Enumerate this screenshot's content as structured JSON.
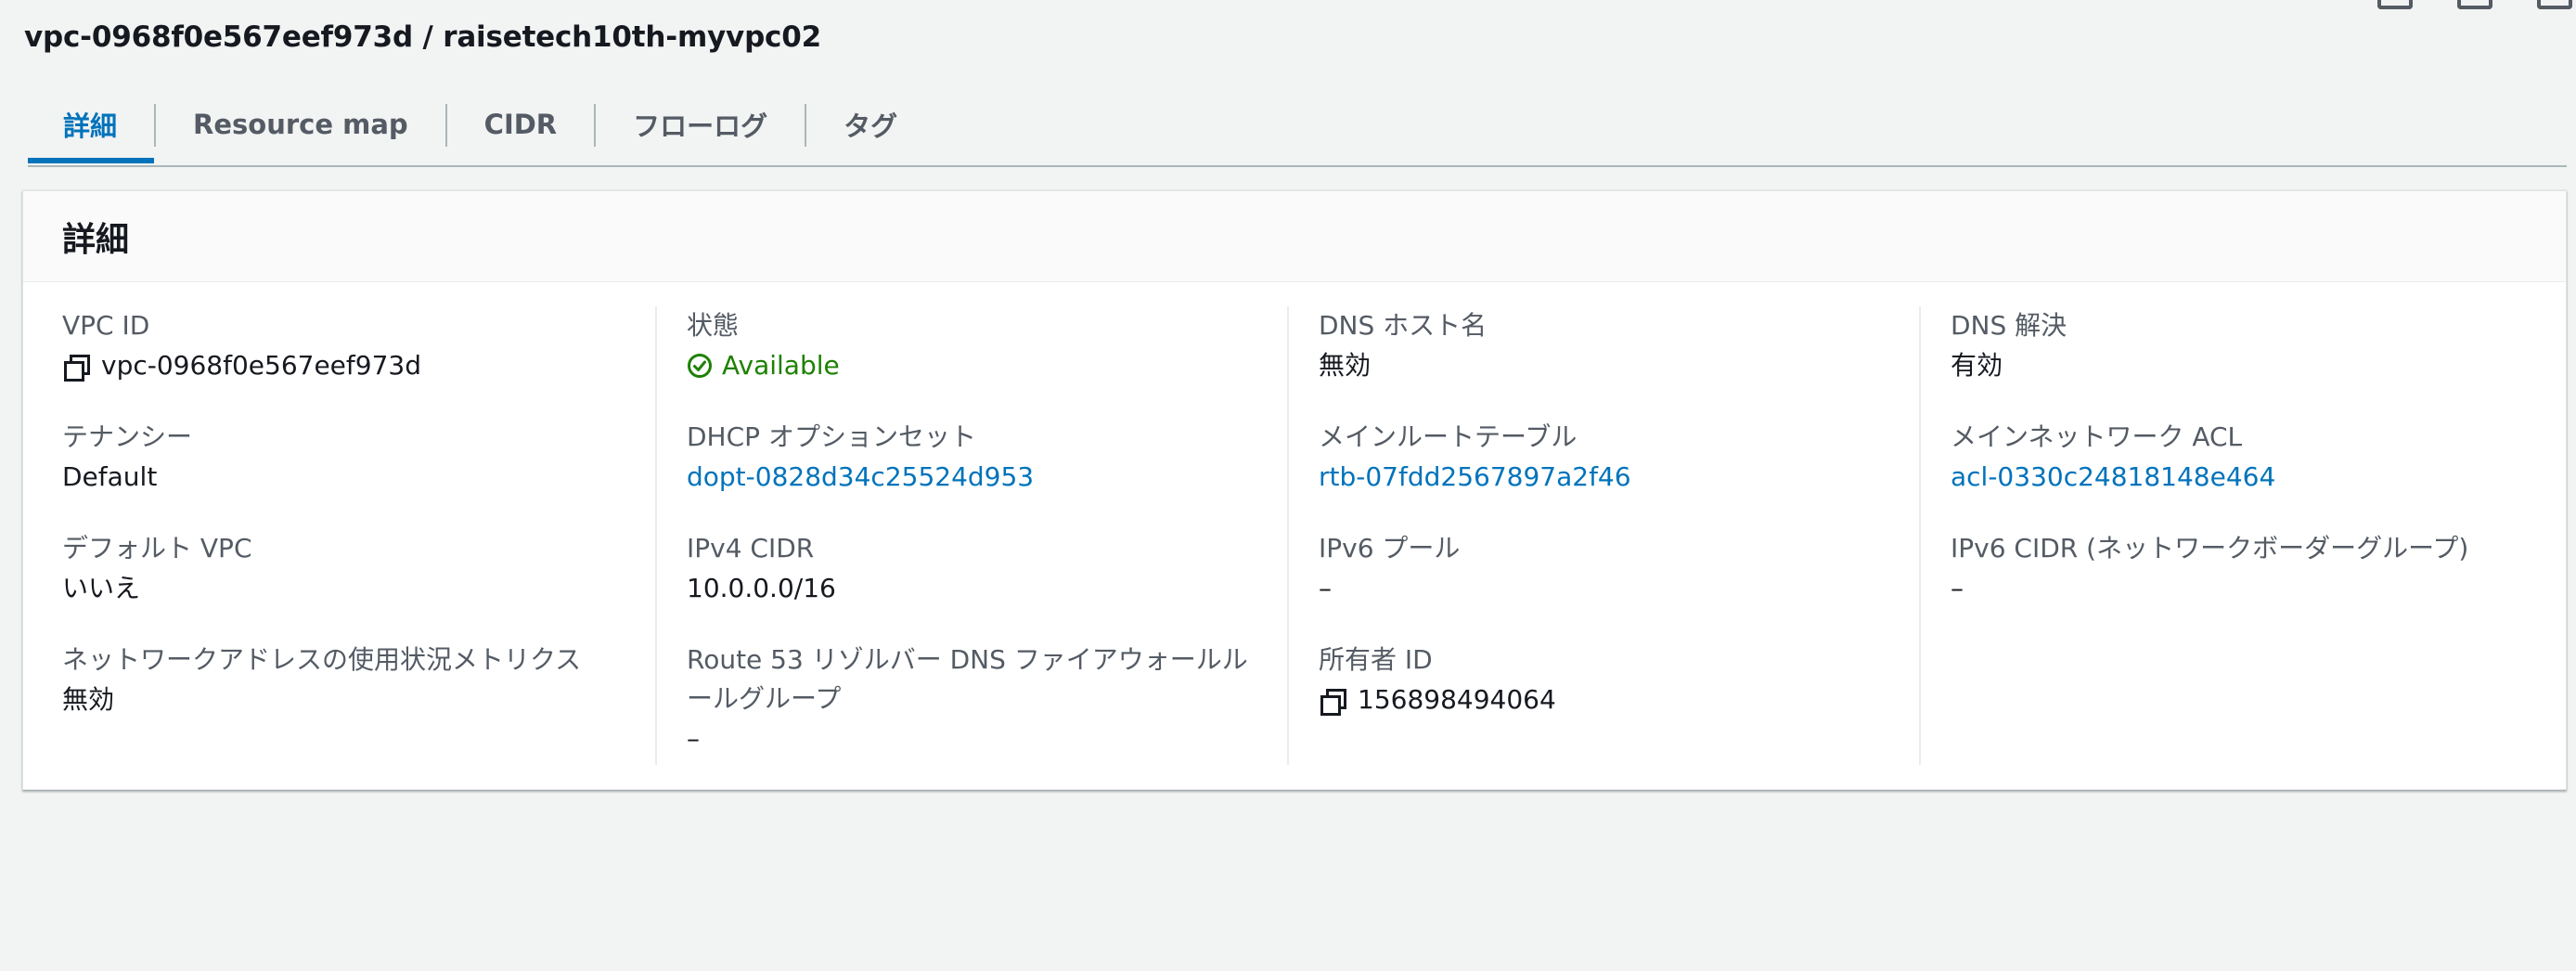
{
  "header": {
    "title": "vpc-0968f0e567eef973d / raisetech10th-myvpc02"
  },
  "tabs": [
    {
      "label": "詳細",
      "active": true
    },
    {
      "label": "Resource map",
      "active": false
    },
    {
      "label": "CIDR",
      "active": false
    },
    {
      "label": "フローログ",
      "active": false
    },
    {
      "label": "タグ",
      "active": false
    }
  ],
  "panel": {
    "title": "詳細",
    "columns": [
      [
        {
          "label": "VPC ID",
          "value": "vpc-0968f0e567eef973d",
          "copy_icon": "copy-icon"
        },
        {
          "label": "テナンシー",
          "value": "Default"
        },
        {
          "label": "デフォルト VPC",
          "value": "いいえ"
        },
        {
          "label": "ネットワークアドレスの使用状況メトリクス",
          "value": "無効"
        }
      ],
      [
        {
          "label": "状態",
          "value": "Available",
          "status_icon": "status-available-icon"
        },
        {
          "label": "DHCP オプションセット",
          "value": "dopt-0828d34c25524d953"
        },
        {
          "label": "IPv4 CIDR",
          "value": "10.0.0.0/16"
        },
        {
          "label": "Route 53 リゾルバー DNS ファイアウォールルールグループ",
          "value": "–"
        }
      ],
      [
        {
          "label": "DNS ホスト名",
          "value": "無効"
        },
        {
          "label": "メインルートテーブル",
          "value": "rtb-07fdd2567897a2f46"
        },
        {
          "label": "IPv6 プール",
          "value": "–"
        },
        {
          "label": "所有者 ID",
          "value": "156898494064",
          "copy_icon": "copy-icon"
        }
      ],
      [
        {
          "label": "DNS 解決",
          "value": "有効"
        },
        {
          "label": "メインネットワーク ACL",
          "value": "acl-0330c24818148e464"
        },
        {
          "label": "IPv6 CIDR (ネットワークボーダーグループ)",
          "value": "–"
        }
      ]
    ]
  },
  "colors": {
    "link": "#0073bb",
    "success": "#1d8102",
    "background": "#f2f3f3",
    "label": "#545b64"
  }
}
